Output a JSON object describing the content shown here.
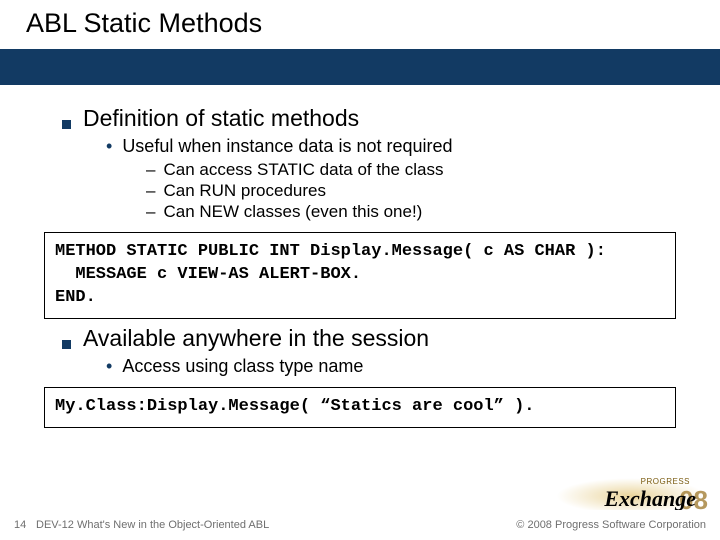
{
  "title": "ABL Static Methods",
  "section1": {
    "heading": "Definition of static methods",
    "sub": "Useful when instance data is not required",
    "points": [
      "Can access STATIC data of the class",
      "Can RUN procedures",
      "Can NEW classes (even this one!)"
    ],
    "code": "METHOD STATIC PUBLIC INT Display.Message( c AS CHAR ):\n  MESSAGE c VIEW-AS ALERT-BOX.\nEND."
  },
  "section2": {
    "heading": "Available anywhere in the session",
    "sub": "Access using class type name",
    "code": "My.Class:Display.Message( “Statics are cool” )."
  },
  "footer": {
    "page": "14",
    "deck": "DEV-12 What's New in the Object-Oriented ABL",
    "copyright": "© 2008 Progress Software Corporation"
  },
  "logo": {
    "small": "PROGRESS",
    "word": "Exchange",
    "year": "08"
  }
}
